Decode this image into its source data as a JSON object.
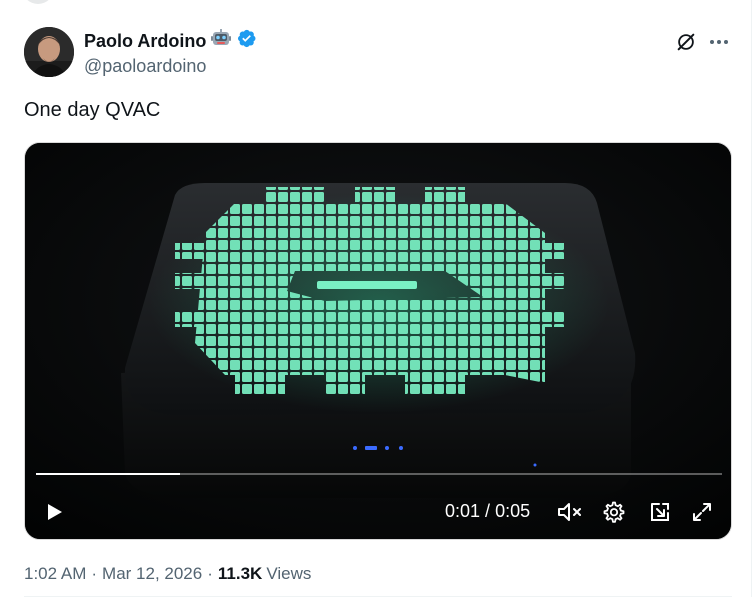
{
  "post": {
    "author": {
      "name": "Paolo Ardoino",
      "handle": "@paoloardoino",
      "verified": true,
      "emoji_icon": "robot-emoji-icon"
    },
    "text": "One day QVAC",
    "timestamp": "1:02 AM",
    "date": "Mar 12, 2026",
    "views_count": "11.3K",
    "views_label": "Views",
    "separator": "·"
  },
  "video": {
    "current_time": "0:01",
    "duration": "0:05",
    "time_separator": "/",
    "progress_fraction": 0.21,
    "controls": [
      "play-icon",
      "volume-muted-icon",
      "settings-gear-icon",
      "picture-in-picture-icon",
      "fullscreen-icon"
    ]
  },
  "colors": {
    "verified_blue": "#1d9bf0",
    "secondary_text": "#536471",
    "primary_text": "#0f1419",
    "screen_glow": "#7af0c4"
  }
}
